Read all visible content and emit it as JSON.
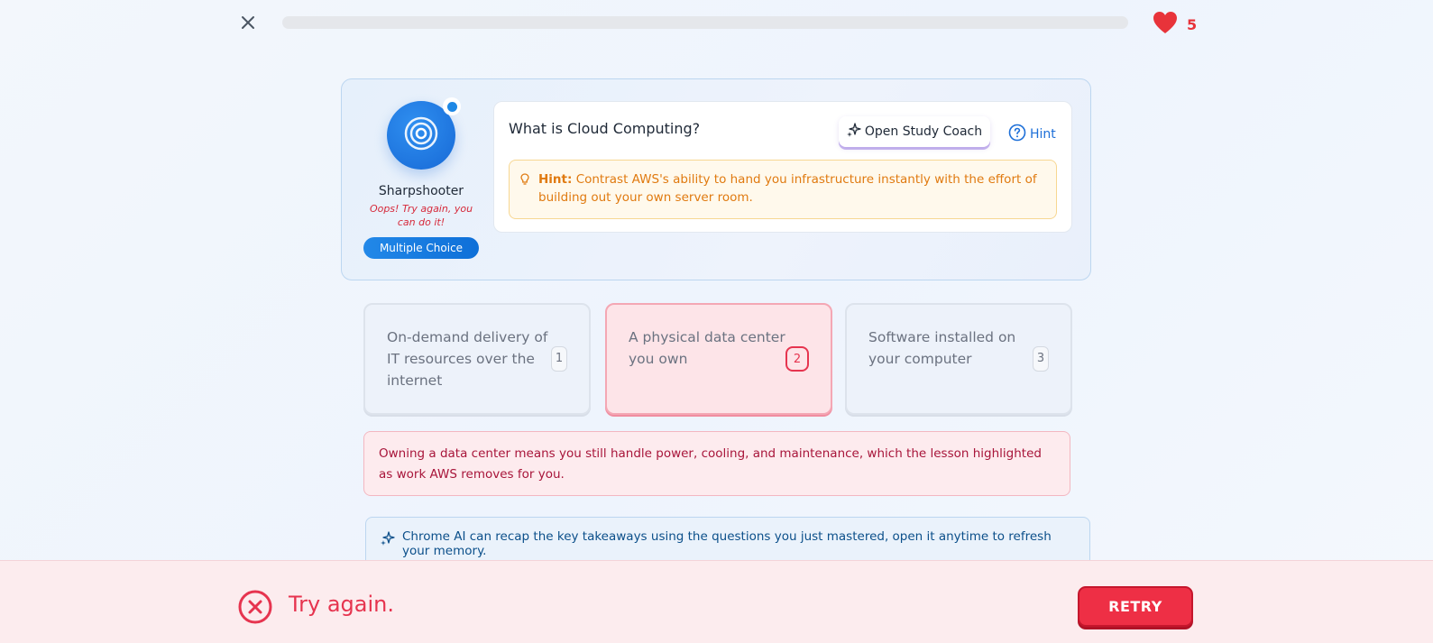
{
  "top": {
    "progress_fraction": 0,
    "hearts_count": "5"
  },
  "mascot": {
    "name": "Sharpshooter",
    "message": "Oops! Try again, you can do it!",
    "question_type": "Multiple Choice"
  },
  "question": {
    "text": "What is Cloud Computing?",
    "coach_button": "Open Study Coach",
    "hint_link": "Hint",
    "hint_label": "Hint:",
    "hint_text": "Contrast AWS's ability to hand you infrastructure instantly with the effort of building out your own server room."
  },
  "options": [
    {
      "text": "On-demand delivery of IT resources over the internet",
      "number": "1",
      "state": "default"
    },
    {
      "text": "A physical data center you own",
      "number": "2",
      "state": "wrong"
    },
    {
      "text": "Software installed on your computer",
      "number": "3",
      "state": "default"
    }
  ],
  "feedback": "Owning a data center means you still handle power, cooling, and maintenance, which the lesson highlighted as work AWS removes for you.",
  "ai_recap": "Chrome AI can recap the key takeaways using the questions you just mastered, open it anytime to refresh your memory.",
  "bottom": {
    "status_text": "Try again.",
    "retry_label": "RETRY"
  },
  "colors": {
    "error": "#e6344f",
    "primary_blue": "#1d6fd8",
    "hint_orange": "#e07a10"
  },
  "icons": [
    "close-icon",
    "heart-icon",
    "target-icon",
    "sparkles-icon",
    "help-circle-icon",
    "lightbulb-icon",
    "x-circle-icon"
  ]
}
